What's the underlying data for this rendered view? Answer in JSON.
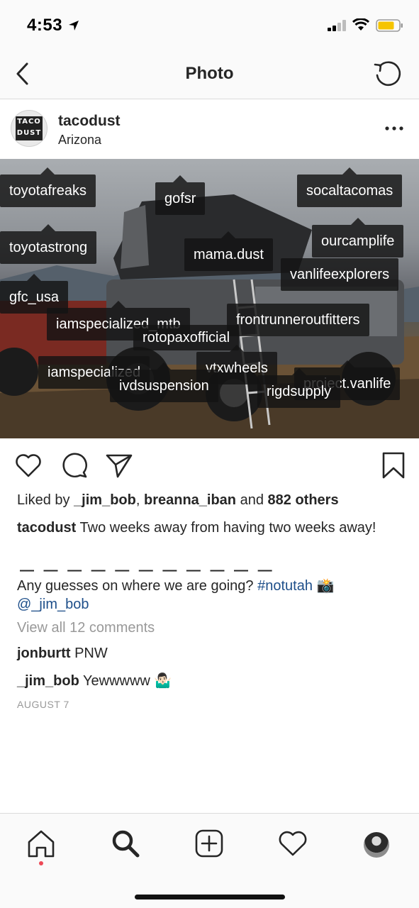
{
  "status_bar": {
    "time": "4:53"
  },
  "nav": {
    "title": "Photo"
  },
  "post": {
    "username": "tacodust",
    "location": "Arizona",
    "avatar_text": "TACO DUST",
    "tags": [
      "toyotafreaks",
      "gofsr",
      "socaltacomas",
      "toyotastrong",
      "ourcamplife",
      "mama.dust",
      "vanlifeexplorers",
      "gfc_usa",
      "iamspecialized_mtb",
      "frontrunneroutfitters",
      "rotopaxofficial",
      "iamspecialized",
      "vtxwheels",
      "project.vanlife",
      "ivdsuspension",
      "rigdsupply"
    ]
  },
  "likes": {
    "prefix": "Liked by ",
    "user1": "_jim_bob",
    "sep": ", ",
    "user2": "breanna_iban",
    "and": " and ",
    "others": "882 others"
  },
  "caption": {
    "username": "tacodust",
    "text": " Two weeks away from having two weeks away!",
    "dashes": "— — — — — — — — — — —",
    "question": "Any guesses on where we are going? ",
    "hashtag": "#notutah",
    "camera_emoji": "📸",
    "mention": "@_jim_bob"
  },
  "view_comments": "View all 12 comments",
  "comments": [
    {
      "user": "jonburtt",
      "text": " PNW"
    },
    {
      "user": "_jim_bob",
      "text": " Yewwwww ",
      "emoji": "🤷🏻‍♂️"
    }
  ],
  "date": "AUGUST 7",
  "colors": {
    "link": "#1e4f8a",
    "muted": "#999999",
    "notification": "#ed4956",
    "battery": "#f5c400"
  },
  "icons": [
    "location-arrow-icon",
    "signal-icon",
    "wifi-icon",
    "battery-icon",
    "back-chevron-icon",
    "refresh-icon",
    "more-dots-icon",
    "heart-icon",
    "comment-icon",
    "share-icon",
    "bookmark-icon",
    "home-icon",
    "search-icon",
    "add-post-icon",
    "activity-heart-icon"
  ]
}
